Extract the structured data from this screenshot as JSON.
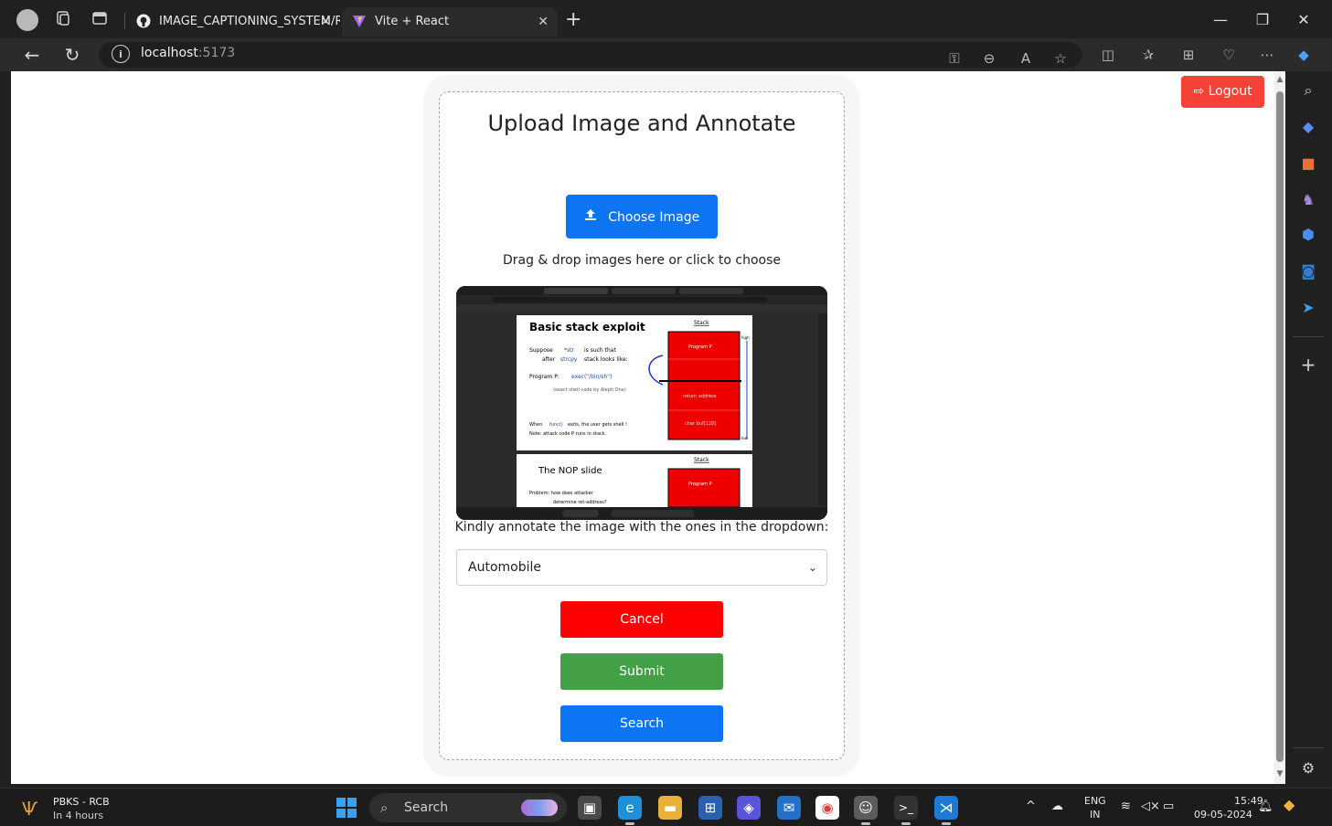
{
  "browser": {
    "tabs": [
      {
        "label": "IMAGE_CAPTIONING_SYSTEM/RE",
        "icon": "github-icon"
      },
      {
        "label": "Vite + React",
        "icon": "vite-icon"
      }
    ],
    "url_host": "localhost",
    "url_port": ":5173",
    "tab_close_glyph": "✕",
    "new_tab_glyph": "+"
  },
  "page": {
    "logout_label": "Logout",
    "title": "Upload Image and Annotate",
    "choose_label": "Choose Image",
    "drag_text": "Drag & drop images here or click to choose",
    "annotate_text": "Kindly annotate the image with the ones in the dropdown:",
    "select_value": "Automobile",
    "cancel_label": "Cancel",
    "submit_label": "Submit",
    "search_label": "Search",
    "preview": {
      "slide1_title": "Basic stack exploit",
      "slide1_line1a": "Suppose",
      "slide1_line1b": "*str",
      "slide1_line1c": "is such that",
      "slide1_line2a": "after",
      "slide1_line2b": "strcpy",
      "slide1_line2c": "stack looks like:",
      "slide1_line3a": "Program P:",
      "slide1_line3b": "exec(\"/bin/sh\")",
      "slide1_line4": "(exact shell code by Aleph One)",
      "slide1_line5a": "When",
      "slide1_line5b": "func()",
      "slide1_line5c": "exits, the user gets shell !",
      "slide1_line6": "Note: attack code P runs in stack.",
      "stack_label": "Stack",
      "program_p": "Program P",
      "return_address": "return address",
      "char_buf": "char buf[128]",
      "high": "high",
      "low": "low",
      "slide2_title": "The NOP slide",
      "slide2_line1": "Problem: how does attacker",
      "slide2_line2": "determine ret-address?"
    }
  },
  "taskbar": {
    "weather_title": "PBKS - RCB",
    "weather_sub": "In 4 hours",
    "search_label": "Search",
    "lang_top": "ENG",
    "lang_bottom": "IN",
    "time": "15:49",
    "date": "09-05-2024"
  },
  "colors": {
    "accent_blue": "#0d74f2",
    "logout_red": "#f44336",
    "cancel_red": "#ff0000",
    "submit_green": "#43a047"
  }
}
